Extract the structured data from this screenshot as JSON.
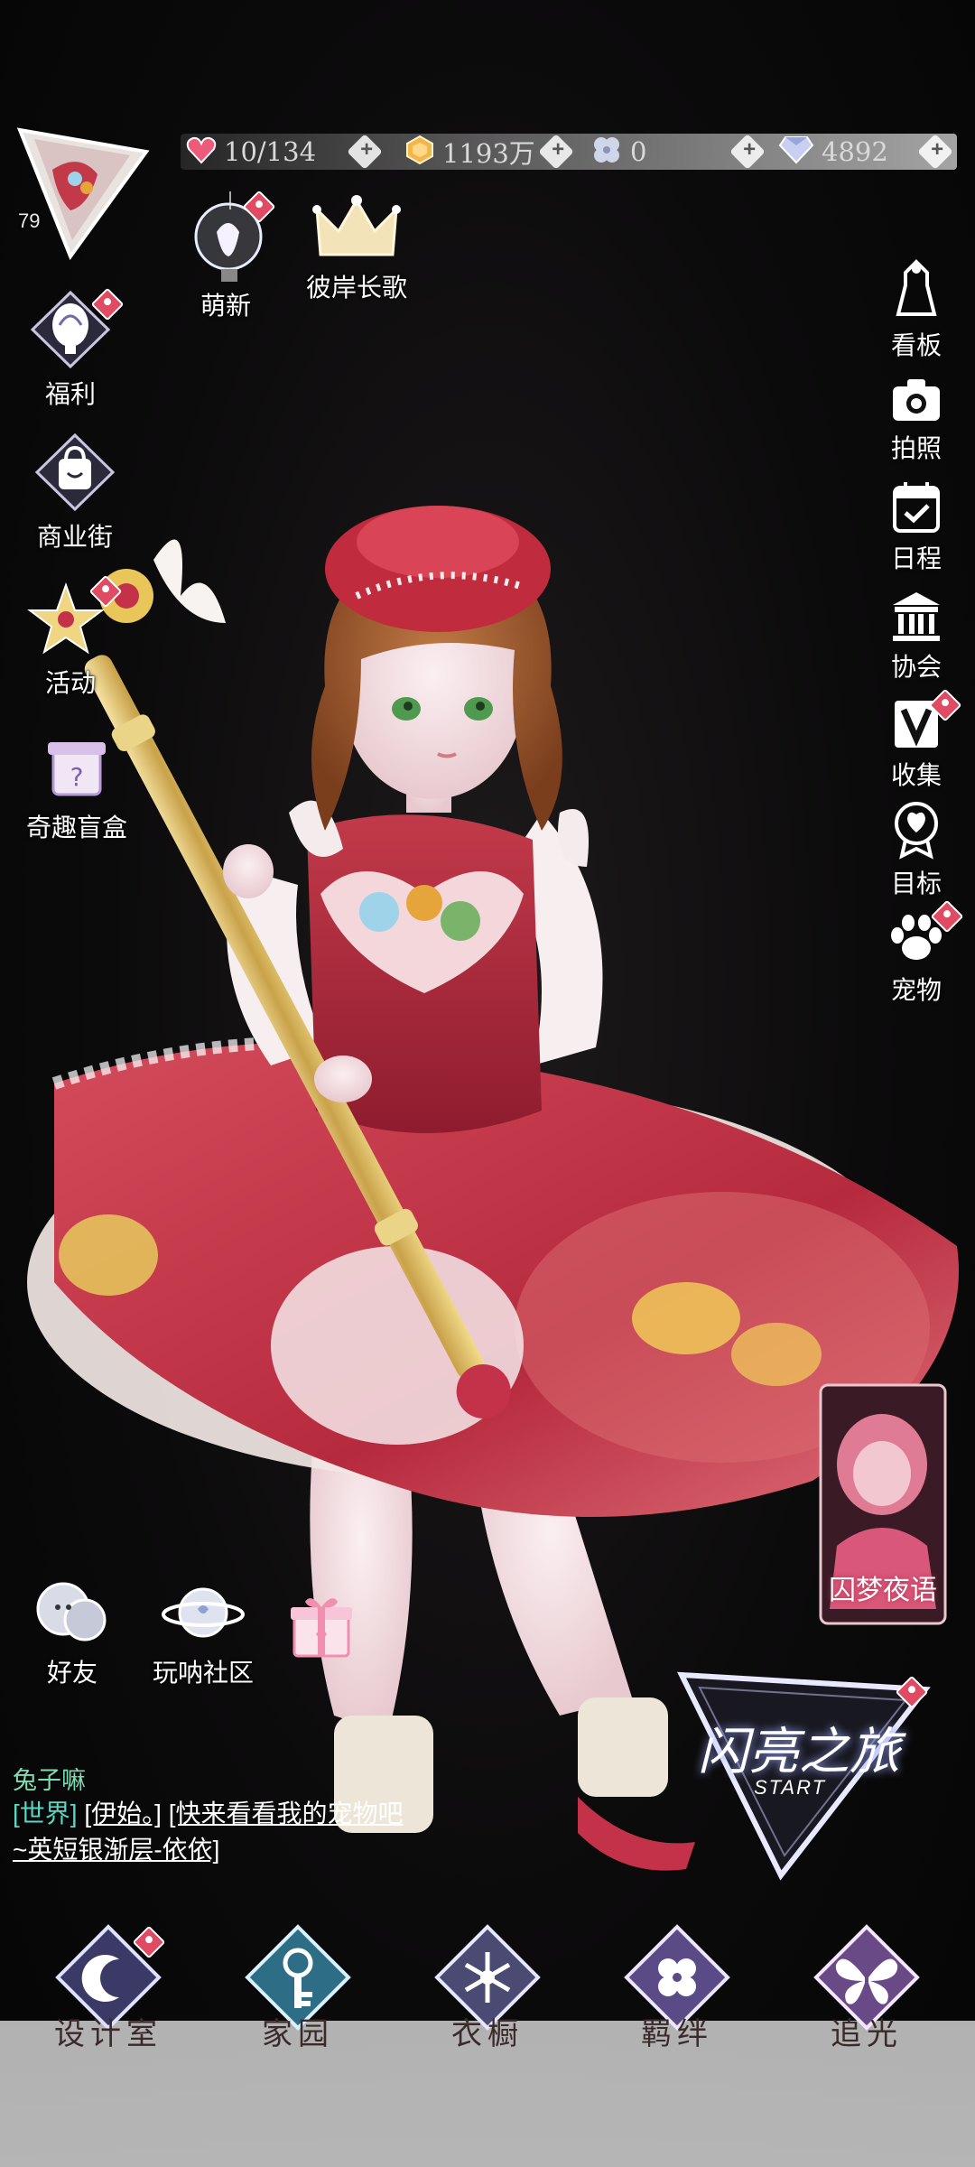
{
  "resources": {
    "stamina": "10/134",
    "gold": "1193万",
    "clover": "0",
    "diamond": "4892"
  },
  "player": {
    "level": "79"
  },
  "top_events": {
    "mengxin": "萌新",
    "biancha": "彼岸长歌"
  },
  "left_menu": {
    "welfare": "福利",
    "street": "商业街",
    "activity": "活动",
    "blindbox": "奇趣盲盒"
  },
  "right_menu": {
    "board": "看板",
    "photo": "拍照",
    "schedule": "日程",
    "guild": "协会",
    "collect": "收集",
    "goal": "目标",
    "pet": "宠物"
  },
  "social": {
    "friends": "好友",
    "community": "玩呐社区"
  },
  "event_card": {
    "title": "囚梦夜语"
  },
  "start_button": {
    "title": "闪亮之旅",
    "sub": "START"
  },
  "chat": {
    "sender": "兔子嘛",
    "channel": "[世界]",
    "user": "[伊始。]",
    "message": "[快来看看我的宠物吧~英短银渐层-依依]"
  },
  "bottom_nav": {
    "design": "设计室",
    "home": "家园",
    "wardrobe": "衣橱",
    "bond": "羁绊",
    "light": "追光"
  },
  "colors": {
    "accent_red": "#e04a62",
    "chat_name": "#7fdcb3",
    "chat_channel": "#58d6c6",
    "bar_bg": "#d6d6d6"
  }
}
